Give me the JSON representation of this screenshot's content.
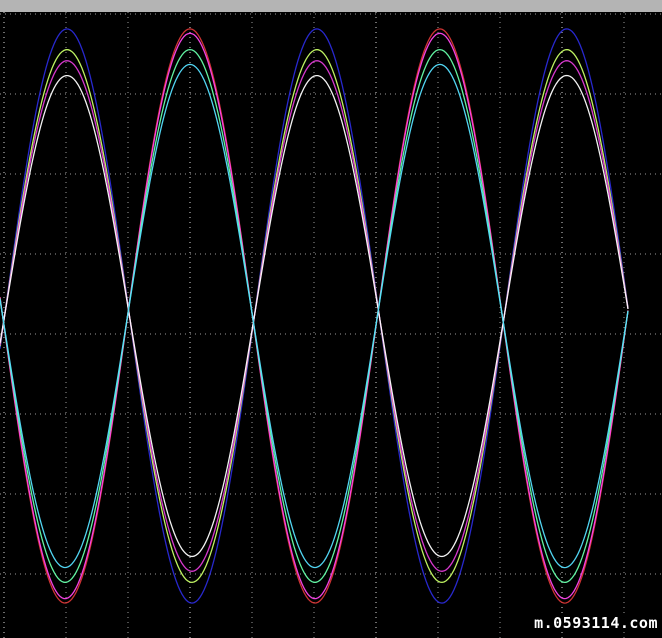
{
  "watermark": "m.0593114.com",
  "colors": {
    "background": "#000000",
    "topbar": "#b4b4b4",
    "grid": "#9a9a9a"
  },
  "chart_data": {
    "type": "line",
    "title": "",
    "xlabel": "",
    "ylabel": "",
    "grid": true,
    "grid_style": "dotted",
    "divisions": {
      "x": 10,
      "y": 8
    },
    "xlim": [
      0,
      10
    ],
    "ylim": [
      -4,
      4
    ],
    "period_div": 4.05,
    "phase_group_a_div": 0.02,
    "phase_group_b_div": 2.05,
    "series": [
      {
        "color": "#2a2ad8",
        "amplitude_div": 3.88,
        "phase": "a"
      },
      {
        "color": "#c8ff66",
        "amplitude_div": 3.6,
        "phase": "a"
      },
      {
        "color": "#e33bd8",
        "amplitude_div": 3.45,
        "phase": "a"
      },
      {
        "color": "#ffffff",
        "amplitude_div": 3.25,
        "phase": "a"
      },
      {
        "color": "#d83535",
        "amplitude_div": 3.88,
        "phase": "b"
      },
      {
        "color": "#ff44ee",
        "amplitude_div": 3.82,
        "phase": "b"
      },
      {
        "color": "#66ffaa",
        "amplitude_div": 3.6,
        "phase": "b"
      },
      {
        "color": "#55e0ff",
        "amplitude_div": 3.4,
        "phase": "b"
      }
    ]
  }
}
